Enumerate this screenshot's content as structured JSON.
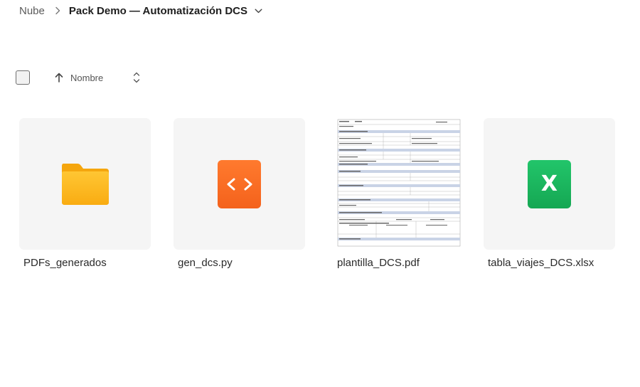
{
  "breadcrumb": {
    "root": "Nube",
    "current": "Pack Demo — Automatización DCS"
  },
  "toolbar": {
    "sort_label": "Nombre",
    "sort_direction": "ascending"
  },
  "files": [
    {
      "name": "PDFs_generados",
      "type": "folder",
      "icon": "folder-icon",
      "color": "#fbb520"
    },
    {
      "name": "gen_dcs.py",
      "type": "code",
      "icon": "code-icon",
      "color": "#f66a24"
    },
    {
      "name": "plantilla_DCS.pdf",
      "type": "pdf",
      "icon": "document-preview"
    },
    {
      "name": "tabla_viajes_DCS.xlsx",
      "type": "spreadsheet",
      "icon": "excel-icon",
      "color": "#1bb85f",
      "glyph": "X"
    }
  ]
}
